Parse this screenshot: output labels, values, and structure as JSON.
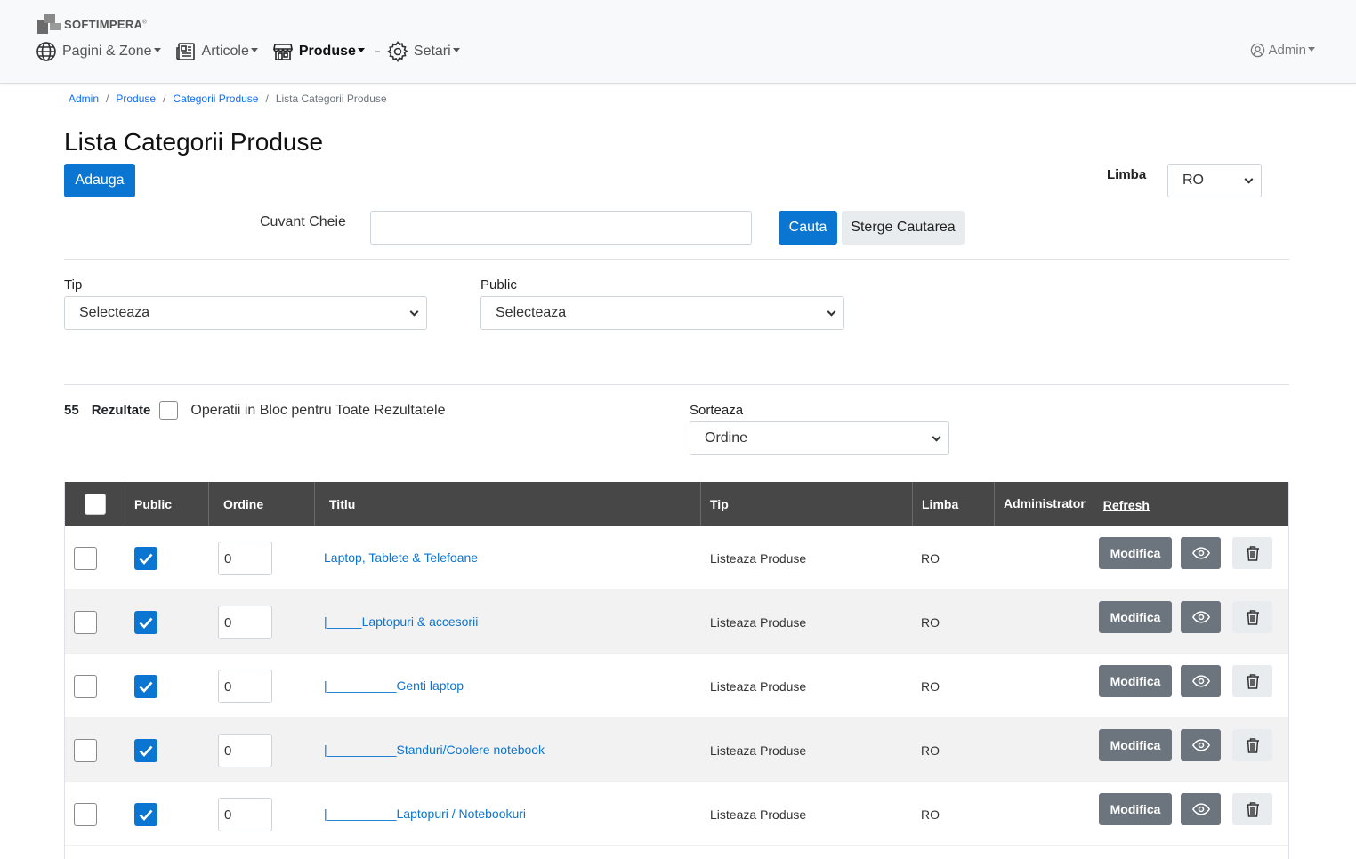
{
  "brand": {
    "name": "SOFTIMPERA",
    "reg": "®"
  },
  "nav": {
    "items": [
      {
        "label": "Pagini & Zone",
        "icon": "globe-icon"
      },
      {
        "label": "Articole",
        "icon": "newspaper-icon"
      },
      {
        "label": "Produse",
        "icon": "store-icon",
        "active": true
      },
      {
        "label": "Setari",
        "icon": "gear-icon"
      }
    ],
    "user": "Admin"
  },
  "breadcrumb": {
    "items": [
      "Admin",
      "Produse",
      "Categorii Produse"
    ],
    "current": "Lista Categorii Produse",
    "separator": "/"
  },
  "page": {
    "title": "Lista Categorii Produse",
    "add_label": "Adauga"
  },
  "language": {
    "label": "Limba",
    "value": "RO"
  },
  "search": {
    "label": "Cuvant Cheie",
    "value": "",
    "search_label": "Cauta",
    "clear_label": "Sterge Cautarea"
  },
  "filters": {
    "tip": {
      "label": "Tip",
      "value": "Selecteaza"
    },
    "public": {
      "label": "Public",
      "value": "Selecteaza"
    }
  },
  "results": {
    "count": "55",
    "label": "Rezultate",
    "bulk_label": "Operatii in Bloc pentru Toate Rezultatele"
  },
  "sort": {
    "label": "Sorteaza",
    "value": "Ordine"
  },
  "table": {
    "headers": {
      "public": "Public",
      "ordine": "Ordine",
      "titlu": "Titlu",
      "tip": "Tip",
      "limba": "Limba",
      "admin": "Administrator",
      "refresh": "Refresh"
    },
    "edit_label": "Modifica",
    "rows": [
      {
        "title": "Laptop, Tablete & Telefoane",
        "tip": "Listeaza Produse",
        "limba": "RO",
        "ordine": "0",
        "public": true
      },
      {
        "title": "|_____Laptopuri & accesorii",
        "tip": "Listeaza Produse",
        "limba": "RO",
        "ordine": "0",
        "public": true
      },
      {
        "title": "|__________Genti laptop",
        "tip": "Listeaza Produse",
        "limba": "RO",
        "ordine": "0",
        "public": true
      },
      {
        "title": "|__________Standuri/Coolere notebook",
        "tip": "Listeaza Produse",
        "limba": "RO",
        "ordine": "0",
        "public": true
      },
      {
        "title": "|__________Laptopuri / Notebookuri",
        "tip": "Listeaza Produse",
        "limba": "RO",
        "ordine": "0",
        "public": true
      }
    ]
  },
  "colors": {
    "primary": "#0b75d2",
    "header_dark": "#474747",
    "secondary": "#6c757d",
    "link": "#0d6efd"
  }
}
